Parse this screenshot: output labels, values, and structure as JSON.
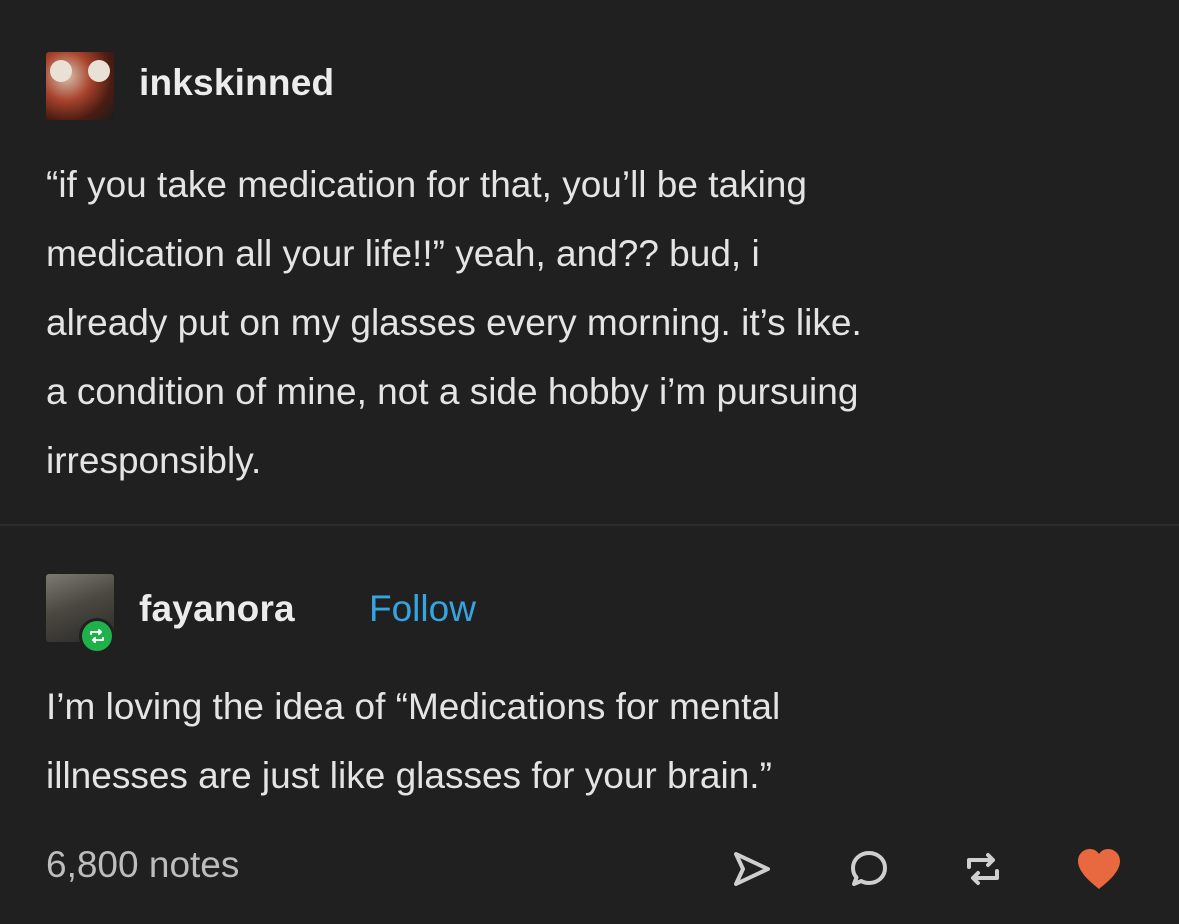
{
  "posts": [
    {
      "username": "inkskinned",
      "avatar_icon": "red-panda-avatar",
      "lines": [
        "“if you take medication for that, you’ll be taking",
        "medication all your life!!” yeah, and?? bud, i",
        "already put on my glasses every morning. it’s like.",
        "a condition of mine, not a side hobby i’m pursuing",
        "irresponsibly."
      ]
    },
    {
      "username": "fayanora",
      "avatar_icon": "user-avatar",
      "follow_label": "Follow",
      "reblog_badge_icon": "reblog-badge-icon",
      "lines": [
        "I’m loving the idea of “Medications for mental",
        "illnesses are just like glasses for your brain.”"
      ]
    }
  ],
  "footer": {
    "notes": "6,800 notes",
    "icons": [
      "share-icon",
      "reply-icon",
      "reblog-icon",
      "like-icon"
    ]
  },
  "colors": {
    "background": "#202020",
    "follow": "#35a4e0",
    "like": "#e8683f",
    "reblog_badge": "#1fb14a"
  }
}
